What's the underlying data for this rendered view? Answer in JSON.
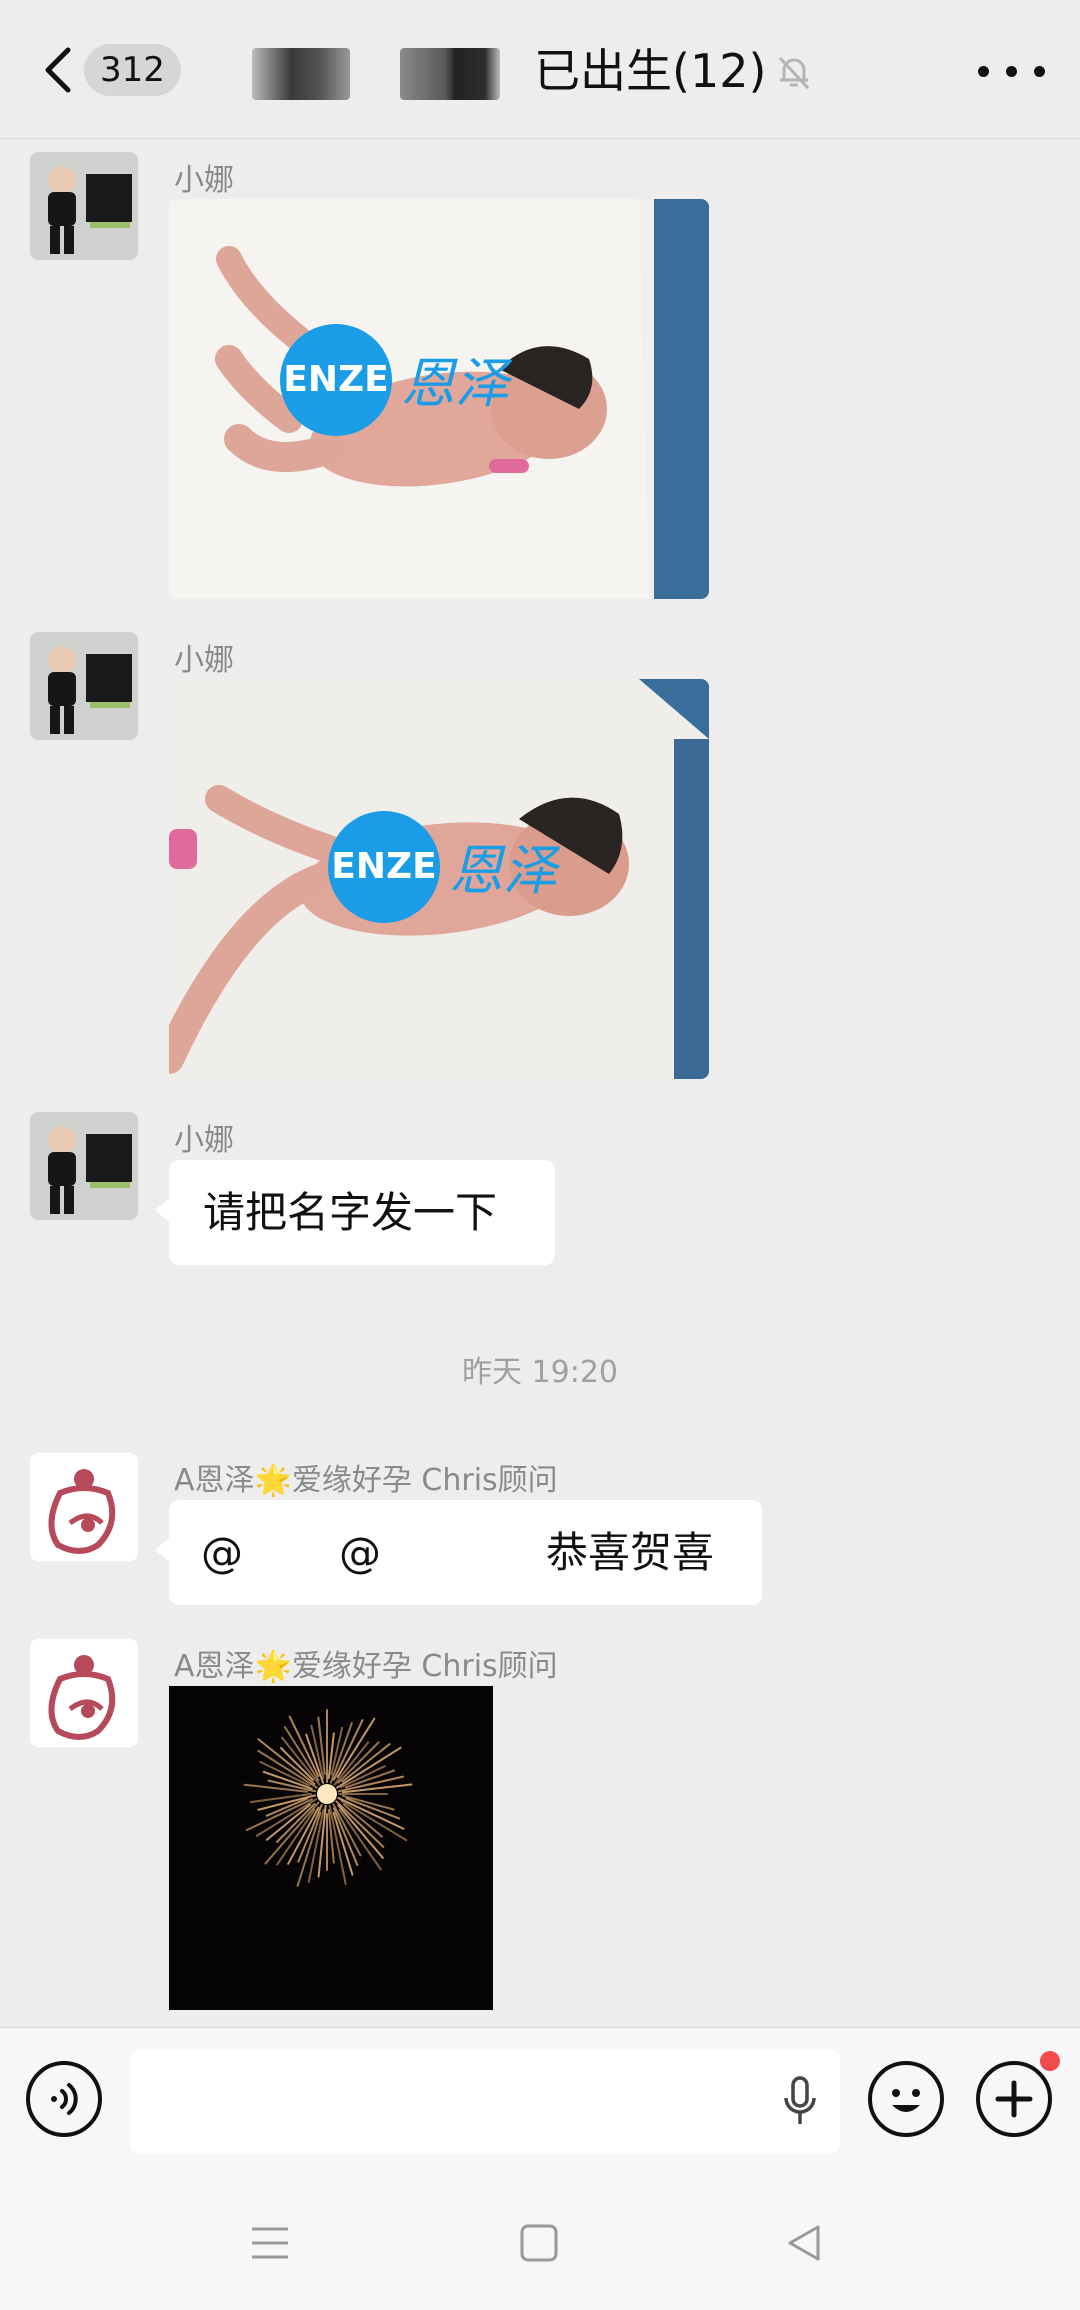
{
  "header": {
    "unread_count": "312",
    "title": "已出生(12)",
    "colors": {
      "background": "#ededed"
    }
  },
  "messages": [
    {
      "type": "image",
      "sender": "小娜",
      "watermark_text": "ENZE",
      "watermark_cn": "恩泽"
    },
    {
      "type": "image",
      "sender": "小娜",
      "watermark_text": "ENZE",
      "watermark_cn": "恩泽"
    },
    {
      "type": "text",
      "sender": "小娜",
      "text": "请把名字发一下"
    },
    {
      "type": "timestamp",
      "text": "昨天 19:20"
    },
    {
      "type": "text",
      "sender": "A恩泽🌟爱缘好孕 Chris顾问",
      "mention1": "@",
      "mention2": "@",
      "text": "恭喜贺喜"
    },
    {
      "type": "image",
      "sender": "A恩泽🌟爱缘好孕 Chris顾问",
      "image_desc": "fireworks"
    }
  ],
  "icons": {
    "back": "chevron-left-icon",
    "mute": "bell-off-icon",
    "more": "more-dots-icon",
    "voice": "voice-icon",
    "mic": "microphone-icon",
    "emoji": "emoji-icon",
    "plus": "plus-icon",
    "nav_menu": "menu-icon",
    "nav_home": "home-square-icon",
    "nav_back": "triangle-back-icon"
  }
}
